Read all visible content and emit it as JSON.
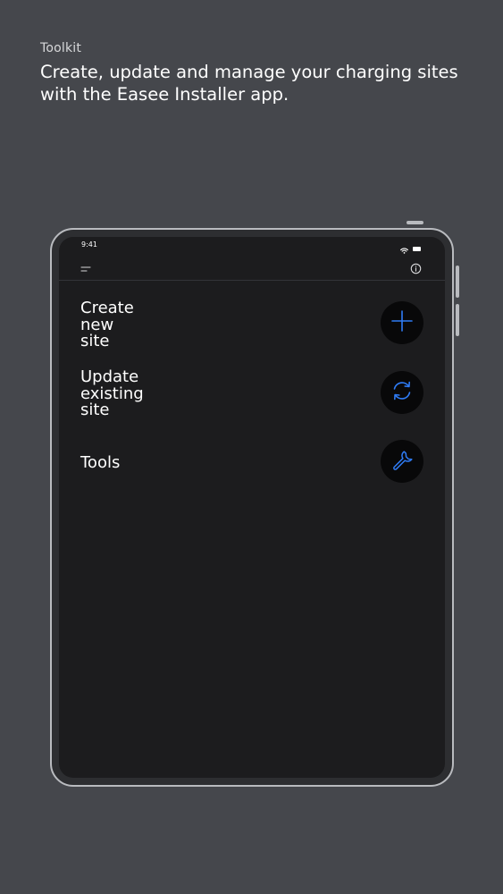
{
  "header": {
    "eyebrow": "Toolkit",
    "headline": "Create, update and manage your charging sites with the Easee Installer app."
  },
  "device": {
    "status_bar": {
      "time": "9:41",
      "icons": [
        "wifi-icon",
        "battery-icon"
      ]
    },
    "app_bar": {
      "left_icon": "menu-icon",
      "right_icon": "info-icon"
    },
    "actions": [
      {
        "label": "Create\nnew\nsite",
        "icon": "plus-icon"
      },
      {
        "label": "Update\nexisting\nsite",
        "icon": "refresh-icon"
      },
      {
        "label": "Tools",
        "icon": "wrench-icon"
      }
    ]
  },
  "colors": {
    "page_background": "#45474c",
    "screen_background": "#1c1c1e",
    "icon_accent": "#2f7cf6",
    "button_circle": "#080809",
    "device_frame": "#b9bbbf"
  }
}
